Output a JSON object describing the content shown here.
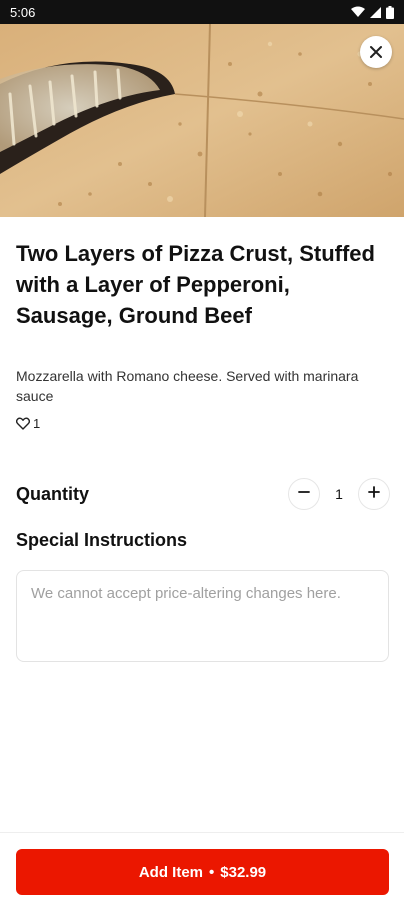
{
  "status_bar": {
    "time": "5:06",
    "icons": [
      "wifi-icon",
      "signal-icon",
      "battery-icon"
    ]
  },
  "hero": {
    "image": "pizza-crust-photo",
    "close_icon": "close-icon"
  },
  "item": {
    "title": "Two Layers of Pizza Crust, Stuffed with a Layer of Pepperoni, Sausage, Ground Beef",
    "description": "Mozzarella with Romano cheese. Served with marinara sauce",
    "like_icon": "heart-outline-icon",
    "likes": "1"
  },
  "quantity": {
    "label": "Quantity",
    "value": "1",
    "decrement_icon": "minus-icon",
    "increment_icon": "plus-icon"
  },
  "special_instructions": {
    "label": "Special Instructions",
    "value": "",
    "placeholder": "We cannot accept price-altering changes here."
  },
  "footer": {
    "button_label": "Add Item",
    "separator": "•",
    "price": "$32.99"
  },
  "colors": {
    "accent": "#eb1700",
    "status_bar": "#111111",
    "placeholder": "#a0a0a0"
  }
}
